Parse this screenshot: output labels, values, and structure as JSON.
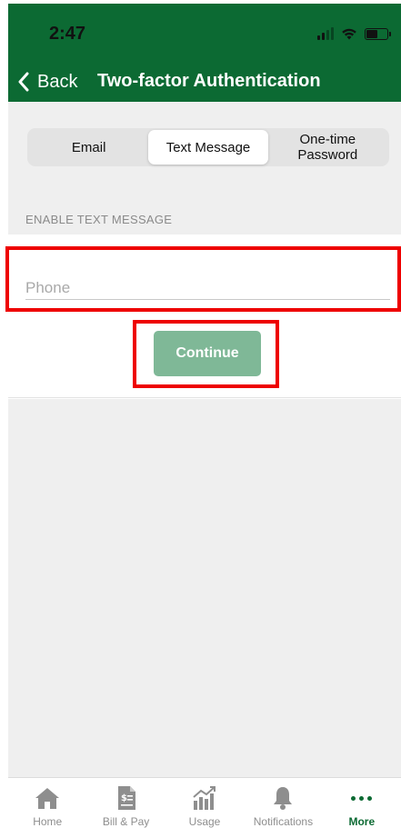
{
  "status_bar": {
    "time": "2:47"
  },
  "header": {
    "back_label": "Back",
    "title": "Two-factor Authentication",
    "background_color": "#0c6a33"
  },
  "segments": [
    {
      "label": "Email",
      "active": false
    },
    {
      "label": "Text Message",
      "active": true
    },
    {
      "label": "One-time\nPassword",
      "active": false
    }
  ],
  "section_label": "ENABLE TEXT MESSAGE",
  "phone_field": {
    "placeholder": "Phone",
    "value": ""
  },
  "continue_button": {
    "label": "Continue",
    "color": "#7fb897"
  },
  "highlight_color": "#ee0000",
  "tabbar": {
    "items": [
      {
        "label": "Home",
        "icon": "home-icon",
        "active": false
      },
      {
        "label": "Bill & Pay",
        "icon": "bill-document-icon",
        "active": false
      },
      {
        "label": "Usage",
        "icon": "usage-chart-icon",
        "active": false
      },
      {
        "label": "Notifications",
        "icon": "bell-icon",
        "active": false
      },
      {
        "label": "More",
        "icon": "more-dots-icon",
        "active": true
      }
    ]
  }
}
